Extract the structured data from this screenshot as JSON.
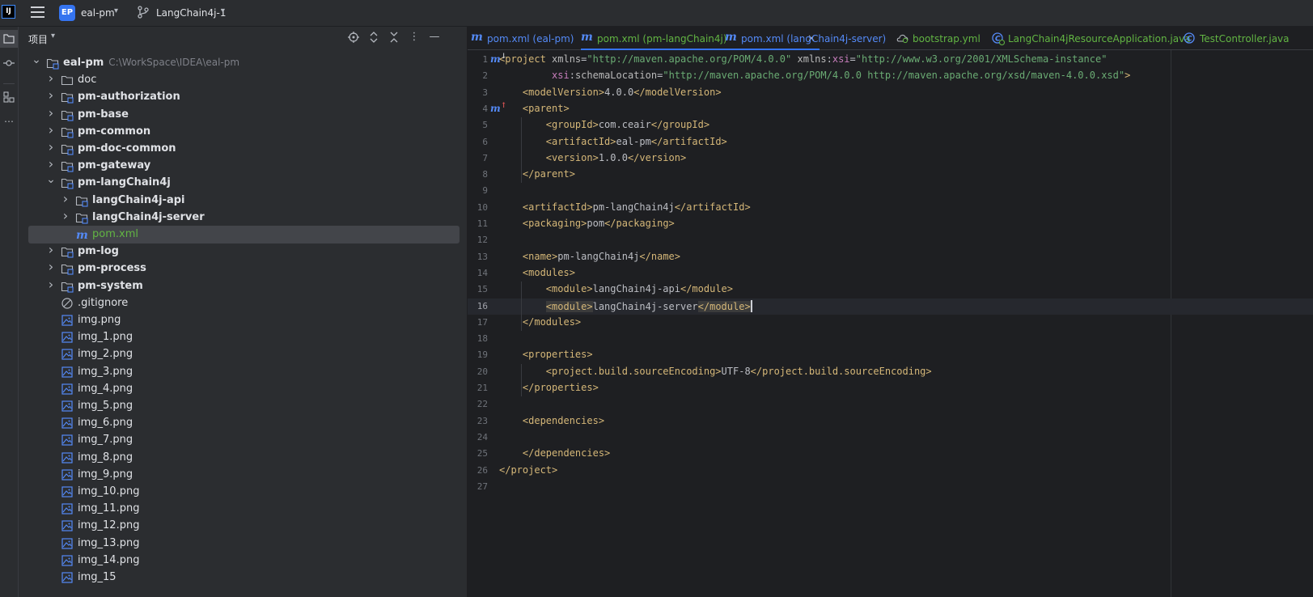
{
  "titlebar": {
    "logo_text": "IJ",
    "project_badge": "EP",
    "project_name": "eal-pm",
    "branch_name": "LangChain4j-1"
  },
  "project_panel": {
    "title": "项目",
    "tree": [
      {
        "label": "eal-pm",
        "path": "C:\\WorkSpace\\IDEA\\eal-pm",
        "depth": 0,
        "arrow": "down",
        "icon": "module-folder-icon",
        "bold": true
      },
      {
        "label": "doc",
        "depth": 1,
        "arrow": "right",
        "icon": "folder-icon",
        "bold": false
      },
      {
        "label": "pm-authorization",
        "depth": 1,
        "arrow": "right",
        "icon": "module-folder-icon",
        "bold": true
      },
      {
        "label": "pm-base",
        "depth": 1,
        "arrow": "right",
        "icon": "module-folder-icon",
        "bold": true
      },
      {
        "label": "pm-common",
        "depth": 1,
        "arrow": "right",
        "icon": "module-folder-icon",
        "bold": true
      },
      {
        "label": "pm-doc-common",
        "depth": 1,
        "arrow": "right",
        "icon": "module-folder-icon",
        "bold": true
      },
      {
        "label": "pm-gateway",
        "depth": 1,
        "arrow": "right",
        "icon": "module-folder-icon",
        "bold": true
      },
      {
        "label": "pm-langChain4j",
        "depth": 1,
        "arrow": "down",
        "icon": "module-folder-icon",
        "bold": true
      },
      {
        "label": "langChain4j-api",
        "depth": 2,
        "arrow": "right",
        "icon": "module-folder-icon",
        "bold": true
      },
      {
        "label": "langChain4j-server",
        "depth": 2,
        "arrow": "right",
        "icon": "module-folder-icon",
        "bold": true
      },
      {
        "label": "pom.xml",
        "depth": 2,
        "arrow": "none",
        "icon": "maven-icon",
        "bold": false,
        "selected": true,
        "xml": true
      },
      {
        "label": "pm-log",
        "depth": 1,
        "arrow": "right",
        "icon": "module-folder-icon",
        "bold": true
      },
      {
        "label": "pm-process",
        "depth": 1,
        "arrow": "right",
        "icon": "module-folder-icon",
        "bold": true
      },
      {
        "label": "pm-system",
        "depth": 1,
        "arrow": "right",
        "icon": "module-folder-icon",
        "bold": true
      },
      {
        "label": ".gitignore",
        "depth": 1,
        "arrow": "none",
        "icon": "ignore-file-icon",
        "bold": false
      },
      {
        "label": "img.png",
        "depth": 1,
        "arrow": "none",
        "icon": "image-file-icon",
        "bold": false
      },
      {
        "label": "img_1.png",
        "depth": 1,
        "arrow": "none",
        "icon": "image-file-icon",
        "bold": false
      },
      {
        "label": "img_2.png",
        "depth": 1,
        "arrow": "none",
        "icon": "image-file-icon",
        "bold": false
      },
      {
        "label": "img_3.png",
        "depth": 1,
        "arrow": "none",
        "icon": "image-file-icon",
        "bold": false
      },
      {
        "label": "img_4.png",
        "depth": 1,
        "arrow": "none",
        "icon": "image-file-icon",
        "bold": false
      },
      {
        "label": "img_5.png",
        "depth": 1,
        "arrow": "none",
        "icon": "image-file-icon",
        "bold": false
      },
      {
        "label": "img_6.png",
        "depth": 1,
        "arrow": "none",
        "icon": "image-file-icon",
        "bold": false
      },
      {
        "label": "img_7.png",
        "depth": 1,
        "arrow": "none",
        "icon": "image-file-icon",
        "bold": false
      },
      {
        "label": "img_8.png",
        "depth": 1,
        "arrow": "none",
        "icon": "image-file-icon",
        "bold": false
      },
      {
        "label": "img_9.png",
        "depth": 1,
        "arrow": "none",
        "icon": "image-file-icon",
        "bold": false
      },
      {
        "label": "img_10.png",
        "depth": 1,
        "arrow": "none",
        "icon": "image-file-icon",
        "bold": false
      },
      {
        "label": "img_11.png",
        "depth": 1,
        "arrow": "none",
        "icon": "image-file-icon",
        "bold": false
      },
      {
        "label": "img_12.png",
        "depth": 1,
        "arrow": "none",
        "icon": "image-file-icon",
        "bold": false
      },
      {
        "label": "img_13.png",
        "depth": 1,
        "arrow": "none",
        "icon": "image-file-icon",
        "bold": false
      },
      {
        "label": "img_14.png",
        "depth": 1,
        "arrow": "none",
        "icon": "image-file-icon",
        "bold": false
      },
      {
        "label": "img_15",
        "depth": 1,
        "arrow": "none",
        "icon": "image-file-icon",
        "bold": false
      }
    ]
  },
  "editor": {
    "tabs": [
      {
        "label": "pom.xml (eal-pm)",
        "icon": "maven-icon",
        "active": false,
        "kind": "maven"
      },
      {
        "label": "pom.xml (pm-langChain4j)",
        "icon": "maven-icon",
        "active": true,
        "kind": "maven",
        "close": "×"
      },
      {
        "label": "pom.xml (langChain4j-server)",
        "icon": "maven-icon",
        "active": false,
        "kind": "maven"
      },
      {
        "label": "bootstrap.yml",
        "icon": "yaml-icon",
        "active": false,
        "kind": "yml"
      },
      {
        "label": "LangChain4jResourceApplication.java",
        "icon": "spring-class-icon",
        "active": false,
        "kind": "java"
      },
      {
        "label": "TestController.java",
        "icon": "class-icon",
        "active": false,
        "kind": "java"
      }
    ],
    "current_line": 16,
    "gutter_markers": [
      {
        "line": 1,
        "icon": "maven-implemented-icon",
        "glyph": "m",
        "sup": "↓"
      },
      {
        "line": 4,
        "icon": "maven-parent-icon",
        "glyph": "m",
        "sup": "↑"
      }
    ],
    "lines": [
      [
        {
          "t": "tag",
          "v": "<project "
        },
        {
          "t": "attr",
          "v": "xmlns"
        },
        {
          "t": "txt",
          "v": "="
        },
        {
          "t": "val",
          "v": "\"http://maven.apache.org/POM/4.0.0\""
        },
        {
          "t": "txt",
          "v": " "
        },
        {
          "t": "attr",
          "v": "xmlns"
        },
        {
          "t": "txt",
          "v": ":"
        },
        {
          "t": "ns",
          "v": "xsi"
        },
        {
          "t": "txt",
          "v": "="
        },
        {
          "t": "val",
          "v": "\"http://www.w3.org/2001/XMLSchema-instance\""
        }
      ],
      [
        {
          "t": "txt",
          "v": "         "
        },
        {
          "t": "ns",
          "v": "xsi"
        },
        {
          "t": "txt",
          "v": ":"
        },
        {
          "t": "attr",
          "v": "schemaLocation"
        },
        {
          "t": "txt",
          "v": "="
        },
        {
          "t": "val",
          "v": "\"http://maven.apache.org/POM/4.0.0 http://maven.apache.org/xsd/maven-4.0.0.xsd\""
        },
        {
          "t": "tag",
          "v": ">"
        }
      ],
      [
        {
          "t": "txt",
          "v": "    "
        },
        {
          "t": "tag",
          "v": "<modelVersion>"
        },
        {
          "t": "txt",
          "v": "4.0.0"
        },
        {
          "t": "tag",
          "v": "</modelVersion>"
        }
      ],
      [
        {
          "t": "txt",
          "v": "    "
        },
        {
          "t": "tag",
          "v": "<parent>"
        }
      ],
      [
        {
          "t": "txt",
          "v": "        "
        },
        {
          "t": "tag",
          "v": "<groupId>"
        },
        {
          "t": "txt",
          "v": "com.ceair"
        },
        {
          "t": "tag",
          "v": "</groupId>"
        }
      ],
      [
        {
          "t": "txt",
          "v": "        "
        },
        {
          "t": "tag",
          "v": "<artifactId>"
        },
        {
          "t": "txt",
          "v": "eal-pm"
        },
        {
          "t": "tag",
          "v": "</artifactId>"
        }
      ],
      [
        {
          "t": "txt",
          "v": "        "
        },
        {
          "t": "tag",
          "v": "<version>"
        },
        {
          "t": "txt",
          "v": "1.0.0"
        },
        {
          "t": "tag",
          "v": "</version>"
        }
      ],
      [
        {
          "t": "txt",
          "v": "    "
        },
        {
          "t": "tag",
          "v": "</parent>"
        }
      ],
      [],
      [
        {
          "t": "txt",
          "v": "    "
        },
        {
          "t": "tag",
          "v": "<artifactId>"
        },
        {
          "t": "txt",
          "v": "pm-langChain4j"
        },
        {
          "t": "tag",
          "v": "</artifactId>"
        }
      ],
      [
        {
          "t": "txt",
          "v": "    "
        },
        {
          "t": "tag",
          "v": "<packaging>"
        },
        {
          "t": "txt",
          "v": "pom"
        },
        {
          "t": "tag",
          "v": "</packaging>"
        }
      ],
      [],
      [
        {
          "t": "txt",
          "v": "    "
        },
        {
          "t": "tag",
          "v": "<name>"
        },
        {
          "t": "txt",
          "v": "pm-langChain4j"
        },
        {
          "t": "tag",
          "v": "</name>"
        }
      ],
      [
        {
          "t": "txt",
          "v": "    "
        },
        {
          "t": "tag",
          "v": "<modules>"
        }
      ],
      [
        {
          "t": "txt",
          "v": "        "
        },
        {
          "t": "tag",
          "v": "<module>"
        },
        {
          "t": "txt",
          "v": "langChain4j-api"
        },
        {
          "t": "tag",
          "v": "</module>"
        }
      ],
      [
        {
          "t": "txt",
          "v": "        "
        },
        {
          "t": "tag hl",
          "v": "<module>"
        },
        {
          "t": "txt",
          "v": "langChain4j-server"
        },
        {
          "t": "tag hl",
          "v": "</module>"
        },
        {
          "t": "caret",
          "v": ""
        }
      ],
      [
        {
          "t": "txt",
          "v": "    "
        },
        {
          "t": "tag",
          "v": "</modules>"
        }
      ],
      [],
      [
        {
          "t": "txt",
          "v": "    "
        },
        {
          "t": "tag",
          "v": "<properties>"
        }
      ],
      [
        {
          "t": "txt",
          "v": "        "
        },
        {
          "t": "tag",
          "v": "<project.build.sourceEncoding>"
        },
        {
          "t": "txt",
          "v": "UTF-8"
        },
        {
          "t": "tag",
          "v": "</project.build.sourceEncoding>"
        }
      ],
      [
        {
          "t": "txt",
          "v": "    "
        },
        {
          "t": "tag",
          "v": "</properties>"
        }
      ],
      [],
      [
        {
          "t": "txt",
          "v": "    "
        },
        {
          "t": "tag",
          "v": "<dependencies>"
        }
      ],
      [],
      [
        {
          "t": "txt",
          "v": "    "
        },
        {
          "t": "tag",
          "v": "</dependencies>"
        }
      ],
      [
        {
          "t": "tag",
          "v": "</project>"
        }
      ],
      []
    ]
  },
  "colors": {
    "accent": "#3574f0",
    "xml_tag": "#d5b778",
    "xml_value": "#6aab73",
    "xml_namespace": "#c77dbb",
    "modified_file": "#62b543"
  }
}
